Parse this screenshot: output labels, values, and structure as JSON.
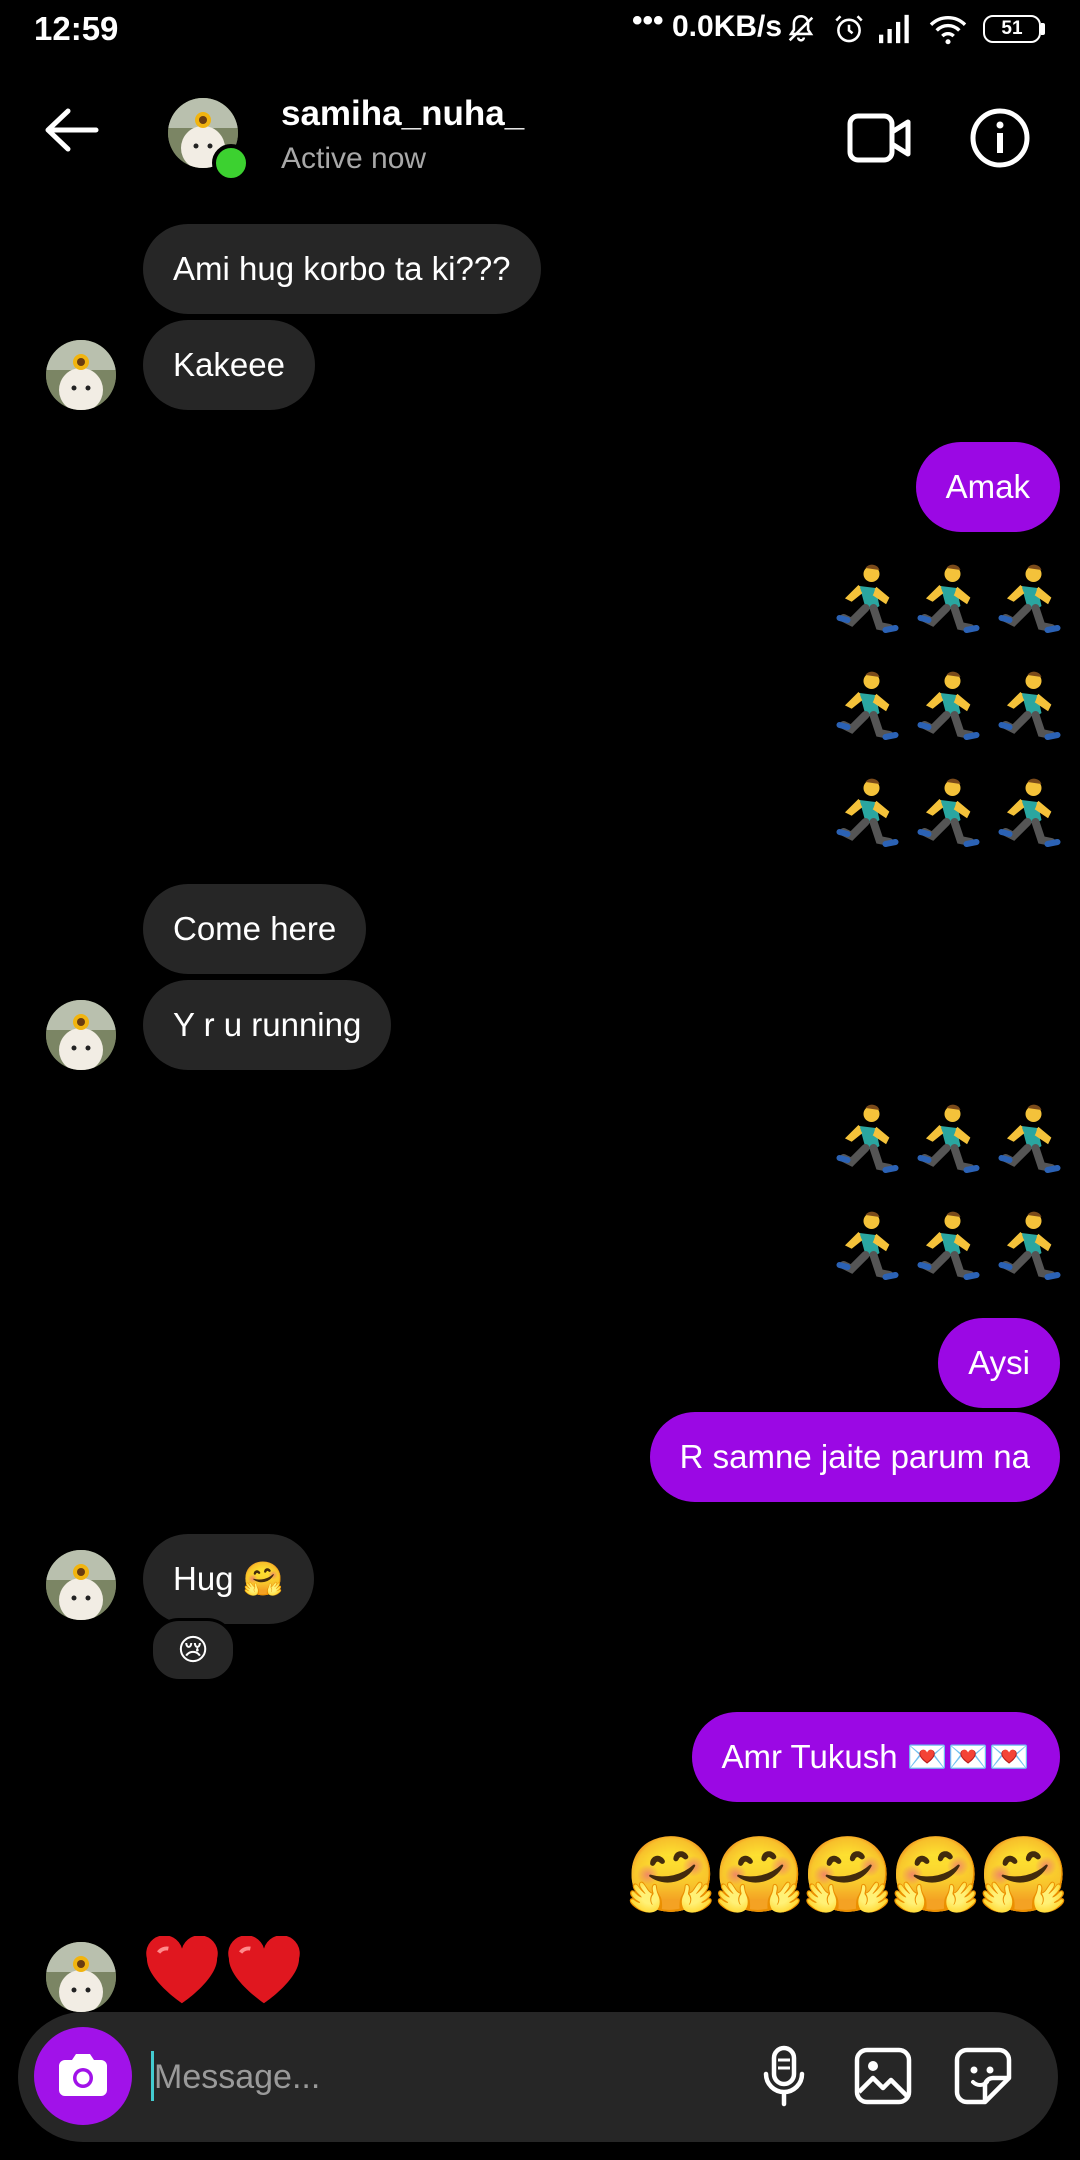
{
  "status_bar": {
    "time": "12:59",
    "network_speed": "0.0KB/s",
    "dots": "•••",
    "battery": "51",
    "icons": [
      "notifications-off-icon",
      "alarm-icon",
      "signal-icon",
      "wifi-icon",
      "battery-icon"
    ]
  },
  "header": {
    "username": "samiha_nuha_",
    "status": "Active now",
    "icons": [
      "back-arrow-icon",
      "video-call-icon",
      "info-icon"
    ],
    "online_color": "#3cd130"
  },
  "messages": {
    "m1": "Ami hug korbo ta ki???",
    "m2": "Kakeee",
    "m3": "Amak",
    "m4": "Come here",
    "m5": "Y r u running",
    "m6": "Aysi",
    "m7": "R samne jaite parum na",
    "m8": "Hug 🤗",
    "m8_reaction": "😢",
    "m9": "Amr Tukush 💌💌💌",
    "hug_row": "🤗🤗🤗🤗🤗",
    "hearts": "❤️❤️"
  },
  "composer": {
    "placeholder": "Message...",
    "icons": [
      "camera-icon",
      "microphone-icon",
      "gallery-icon",
      "sticker-icon"
    ]
  },
  "colors": {
    "outgoing_bubble": "#9b08e4",
    "incoming_bubble": "#262626",
    "camera_button": "#a112e9"
  }
}
